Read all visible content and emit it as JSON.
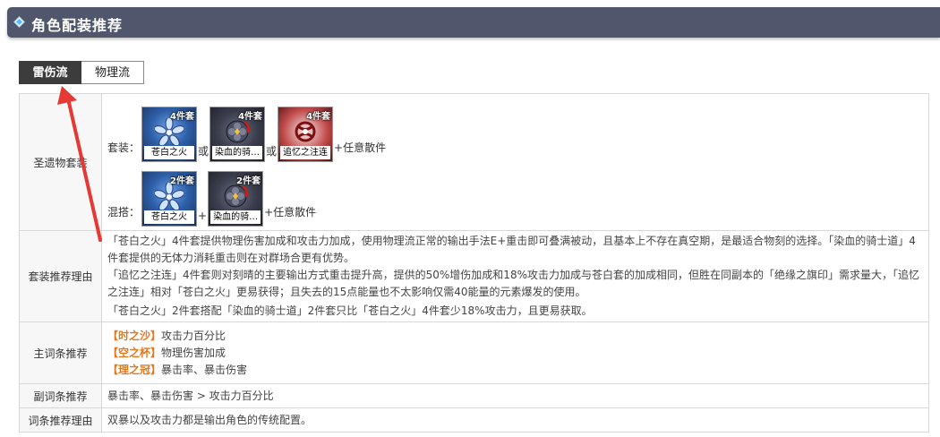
{
  "header": {
    "title": "角色配装推荐"
  },
  "tabs": [
    {
      "label": "雷伤流",
      "active": true
    },
    {
      "label": "物理流",
      "active": false
    }
  ],
  "artifact": {
    "label": "圣遗物套装",
    "set_label": "套装：",
    "mix_label": "混搭：",
    "set_items": [
      {
        "badge": "4件套",
        "name": "苍白之火",
        "color": "blue"
      },
      {
        "badge": "4件套",
        "name": "染血的骑…",
        "color": "dark"
      },
      {
        "badge": "4件套",
        "name": "追忆之注连",
        "color": "red"
      }
    ],
    "or_text": "或",
    "plus_text": "+",
    "tail_text": "+任意散件",
    "mix_items": [
      {
        "badge": "2件套",
        "name": "苍白之火",
        "color": "blue"
      },
      {
        "badge": "2件套",
        "name": "染血的骑…",
        "color": "dark"
      }
    ]
  },
  "reason": {
    "label": "套装推荐理由",
    "lines": [
      "「苍白之火」4件套提供物理伤害加成和攻击力加成，使用物理流正常的输出手法E+重击即可叠满被动，且基本上不存在真空期，是最适合物刻的选择。「染血的骑士道」4件套提供的无体力消耗重击则在对群场合更有优势。",
      "「追忆之注连」4件套则对刻晴的主要输出方式重击提升高，提供的50%增伤加成和18%攻击力加成与苍白套的加成相同，但胜在同副本的「绝缘之旗印」需求量大，「追忆之注连」相对「苍白之火」更易获得；且失去的15点能量也不太影响仅需40能量的元素爆发的使用。",
      "「苍白之火」2件套搭配「染血的骑士道」2件套只比「苍白之火」4件套少18%攻击力，且更易获取。"
    ]
  },
  "main_stat": {
    "label": "主词条推荐",
    "rows": [
      {
        "slot": "【时之沙】",
        "value": "攻击力百分比"
      },
      {
        "slot": "【空之杯】",
        "value": "物理伤害加成"
      },
      {
        "slot": "【理之冠】",
        "value": "暴击率、暴击伤害"
      }
    ]
  },
  "sub_stat": {
    "label": "副词条推荐",
    "value": "暴击率、暴击伤害 > 攻击力百分比"
  },
  "stat_reason": {
    "label": "词条推荐理由",
    "value": "双暴以及攻击力都是输出角色的传统配置。"
  },
  "colors": {
    "header_bg": "#50566b",
    "tab_active": "#3c3c3c",
    "accent_orange": "#e07a1e",
    "arrow_red": "#e53935"
  }
}
